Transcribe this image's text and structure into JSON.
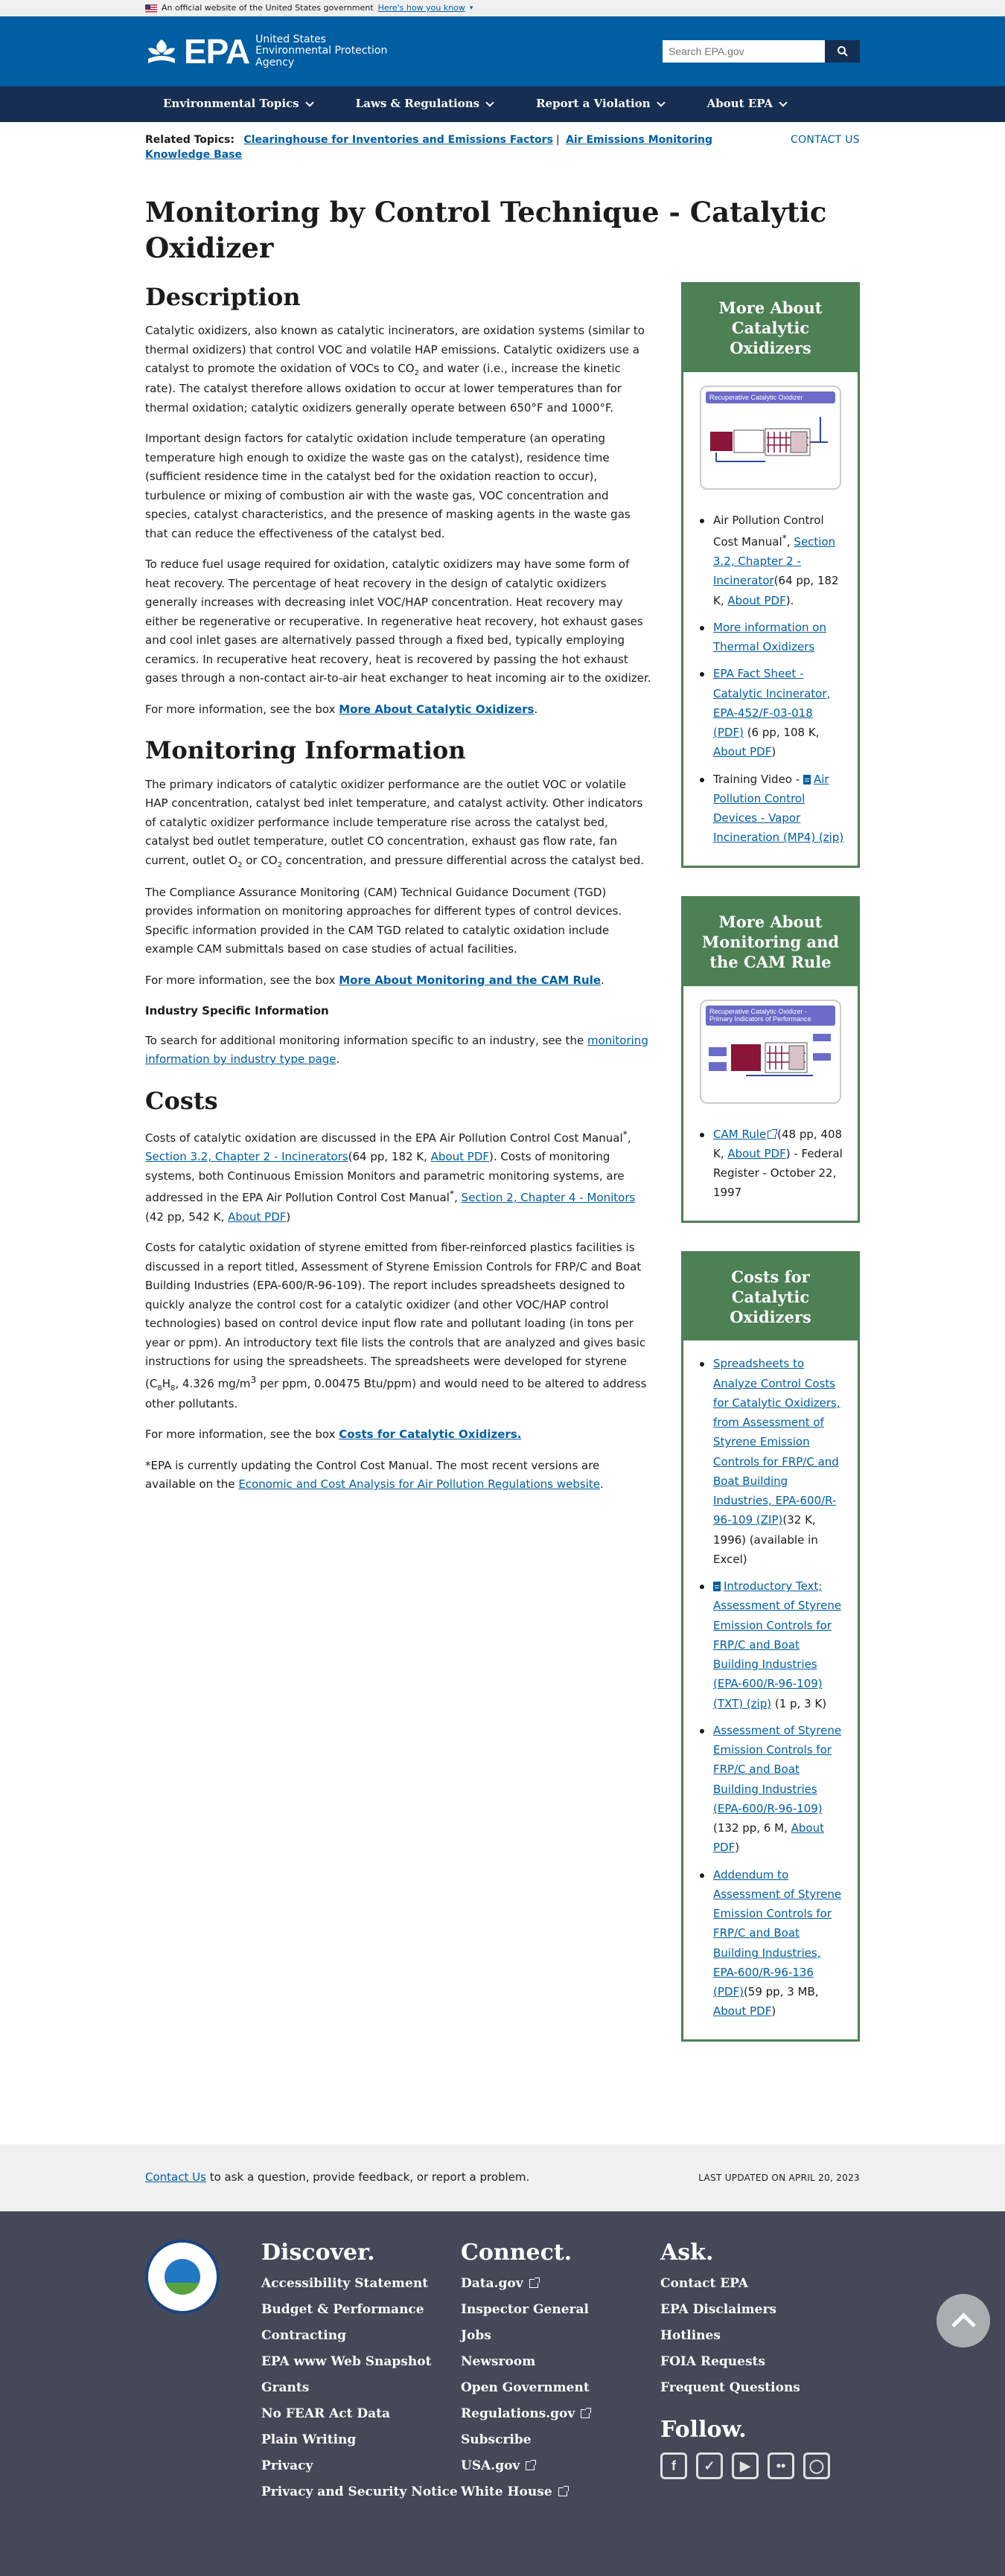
{
  "gov_banner": {
    "text": "An official website of the United States government",
    "link": "Here's how you know"
  },
  "header": {
    "logo_epa": "EPA",
    "logo_line1": "United States",
    "logo_line2": "Environmental Protection",
    "logo_line3": "Agency",
    "search_placeholder": "Search EPA.gov"
  },
  "nav": {
    "items": [
      "Environmental Topics",
      "Laws & Regulations",
      "Report a Violation",
      "About EPA"
    ]
  },
  "related": {
    "label": "Related Topics:",
    "link1": "Clearinghouse for Inventories and Emissions Factors",
    "link2": "Air Emissions Monitoring Knowledge Base",
    "contact": "CONTACT US"
  },
  "page_title": "Monitoring by Control Technique - Catalytic Oxidizer",
  "description": {
    "heading": "Description",
    "p1_a": "Catalytic oxidizers, also known as catalytic incinerators, are oxidation systems (similar to thermal oxidizers) that control VOC and volatile HAP emissions. Catalytic oxidizers use a catalyst to promote the oxidation of VOCs to CO",
    "p1_sub": "2",
    "p1_b": " and water (i.e., increase the kinetic rate). The catalyst therefore allows oxidation to occur at lower temperatures than for thermal oxidation; catalytic oxidizers generally operate between 650°F and 1000°F.",
    "p2": "Important design factors for catalytic oxidation include temperature (an operating temperature high enough to oxidize the waste gas on the catalyst), residence time (sufficient residence time in the catalyst bed for the oxidation reaction to occur), turbulence or mixing of combustion air with the waste gas, VOC concentration and species, catalyst characteristics, and the presence of masking agents in the waste gas that can reduce the effectiveness of the catalyst bed.",
    "p3": "To reduce fuel usage required for oxidation, catalytic oxidizers may have some form of heat recovery. The percentage of heat recovery in the design of catalytic oxidizers generally increases with decreasing inlet VOC/HAP concentration. Heat recovery may either be regenerative or recuperative. In regenerative heat recovery, hot exhaust gases and cool inlet gases are alternatively passed through a fixed bed, typically employing ceramics. In recuperative heat recovery, heat is recovered by passing the hot exhaust gases through a non-contact air-to-air heat exchanger to heat incoming air to the oxidizer.",
    "more_pre": "For more information, see the box ",
    "more_link": "More About Catalytic Oxidizers",
    "more_post": "."
  },
  "monitoring": {
    "heading": "Monitoring Information",
    "p1_a": "The primary indicators of catalytic oxidizer performance are the outlet VOC or volatile HAP concentration, catalyst bed inlet temperature, and catalyst activity. Other indicators of catalytic oxidizer performance include temperature rise across the catalyst bed, catalyst bed outlet temperature, outlet CO concentration, exhaust gas flow rate, fan current, outlet O",
    "p1_sub1": "2",
    "p1_b": " or CO",
    "p1_sub2": "2",
    "p1_c": " concentration, and pressure differential across the catalyst bed.",
    "p2": "The Compliance Assurance Monitoring (CAM) Technical Guidance Document (TGD) provides information on monitoring approaches for different types of control devices. Specific information provided in the CAM TGD related to catalytic oxidation include example CAM submittals based on case studies of actual facilities.",
    "more_pre": "For more information, see the box ",
    "more_link": "More About Monitoring and the CAM Rule",
    "more_post": ".",
    "industry_heading": "Industry Specific Information",
    "industry_pre": "To search for additional monitoring information specific to an industry, see the ",
    "industry_link": "monitoring information by industry type page",
    "industry_post": "."
  },
  "costs": {
    "heading": "Costs",
    "p1_a": "Costs of catalytic oxidation are discussed in the EPA Air Pollution Control Cost Manual",
    "p1_star": "*",
    "p1_b": ", ",
    "p1_link1": "Section 3.2, Chapter 2 - Incinerators",
    "p1_c": "(64 pp, 182 K, ",
    "p1_link2": "About PDF",
    "p1_d": "). Costs of monitoring systems, both Continuous Emission Monitors and parametric monitoring systems, are addressed in the EPA Air Pollution Control Cost Manual",
    "p1_star2": "*",
    "p1_e": ", ",
    "p1_link3": "Section 2, Chapter 4 - Monitors",
    "p1_f": " (42 pp, 542 K, ",
    "p1_link4": "About PDF",
    "p1_g": ")",
    "p2_a": "Costs for catalytic oxidation of styrene emitted from fiber-reinforced plastics facilities is discussed in a report titled, Assessment of Styrene Emission Controls for FRP/C and Boat Building Industries (EPA-600/R-96-109). The report includes spreadsheets designed to quickly analyze the control cost for a catalytic oxidizer (and other VOC/HAP control technologies) based on control device input flow rate and pollutant loading (in tons per year or ppm). An introductory text file lists the controls that are analyzed and gives basic instructions for using the spreadsheets. The spreadsheets were developed for styrene (C",
    "p2_sub1": "8",
    "p2_b": "H",
    "p2_sub2": "8",
    "p2_c": ", 4.326 mg/m",
    "p2_sup": "3",
    "p2_d": " per ppm, 0.00475 Btu/ppm) and would need to be altered to address other pollutants.",
    "more_pre": "For more information, see the box ",
    "more_link": "Costs for Catalytic Oxidizers.",
    "footnote_a": "*EPA is currently updating the Control Cost Manual. The most recent versions are available on the ",
    "footnote_link": "Economic and Cost Analysis for Air Pollution Regulations website",
    "footnote_b": "."
  },
  "sidebar": {
    "box1": {
      "title": "More About Catalytic Oxidizers",
      "diagram_title": "Recuperative Catalytic Oxidizer",
      "i1_a": "Air Pollution Control Cost Manual",
      "i1_star": "*",
      "i1_b": ", ",
      "i1_link": "Section 3.2, Chapter 2 - Incinerator",
      "i1_c": "(64 pp, 182 K, ",
      "i1_link2": "About PDF",
      "i1_d": ").",
      "i2_link": "More information on Thermal Oxidizers",
      "i3_link": "EPA Fact Sheet - Catalytic Incinerator, EPA-452/F-03-018 (PDF)",
      "i3_a": " (6 pp, 108 K, ",
      "i3_link2": "About PDF",
      "i3_b": ")",
      "i4_a": "Training Video - ",
      "i4_link": "Air Pollution Control Devices - Vapor Incineration (MP4) (zip)"
    },
    "box2": {
      "title": "More About Monitoring and the CAM Rule",
      "diagram_title": "Recuperative Catalytic Oxidizer - Primary Indicators of Performance",
      "i1_link": "CAM Rule",
      "i1_a": "(48 pp, 408 K, ",
      "i1_link2": "About PDF",
      "i1_b": ") - Federal Register - October 22, 1997"
    },
    "box3": {
      "title": "Costs for Catalytic Oxidizers",
      "i1_link": "Spreadsheets to Analyze Control Costs for Catalytic Oxidizers, from Assessment of Styrene Emission Controls for FRP/C and Boat Building Industries, EPA-600/R-96-109 (ZIP)",
      "i1_a": "(32 K, 1996) (available in Excel)",
      "i2_link": "Introductory Text; Assessment of Styrene Emission Controls for FRP/C and Boat Building Industries (EPA-600/R-96-109) (TXT) (zip)",
      "i2_a": " (1 p, 3 K)",
      "i3_link": "Assessment of Styrene Emission Controls for FRP/C and Boat Building Industries (EPA-600/R-96-109)",
      "i3_a": " (132 pp, 6 M, ",
      "i3_link2": "About PDF",
      "i3_b": ")",
      "i4_link": "Addendum to Assessment of Styrene Emission Controls for FRP/C and Boat Building Industries, EPA-600/R-96-136 (PDF)",
      "i4_a": "(59 pp, 3 MB, ",
      "i4_link2": "About PDF",
      "i4_b": ")"
    }
  },
  "contact_bar": {
    "link": "Contact Us",
    "text": " to ask a question, provide feedback, or report a problem.",
    "updated": "LAST UPDATED ON APRIL 20, 2023"
  },
  "footer": {
    "discover": {
      "heading": "Discover.",
      "links": [
        "Accessibility Statement",
        "Budget & Performance",
        "Contracting",
        "EPA www Web Snapshot",
        "Grants",
        "No FEAR Act Data",
        "Plain Writing",
        "Privacy",
        "Privacy and Security Notice"
      ]
    },
    "connect": {
      "heading": "Connect.",
      "links": [
        "Data.gov",
        "Inspector General",
        "Jobs",
        "Newsroom",
        "Open Government",
        "Regulations.gov",
        "Subscribe",
        "USA.gov",
        "White House"
      ]
    },
    "ask": {
      "heading": "Ask.",
      "links": [
        "Contact EPA",
        "EPA Disclaimers",
        "Hotlines",
        "FOIA Requests",
        "Frequent Questions"
      ]
    },
    "follow": {
      "heading": "Follow.",
      "icons": [
        "facebook-icon",
        "twitter-icon",
        "youtube-icon",
        "flickr-icon",
        "instagram-icon"
      ]
    }
  },
  "colors": {
    "header_blue": "#005ea2",
    "nav_navy": "#162e51",
    "sidebar_green": "#4d8055",
    "footer_gray": "#444857",
    "link_blue": "#005ea2"
  }
}
